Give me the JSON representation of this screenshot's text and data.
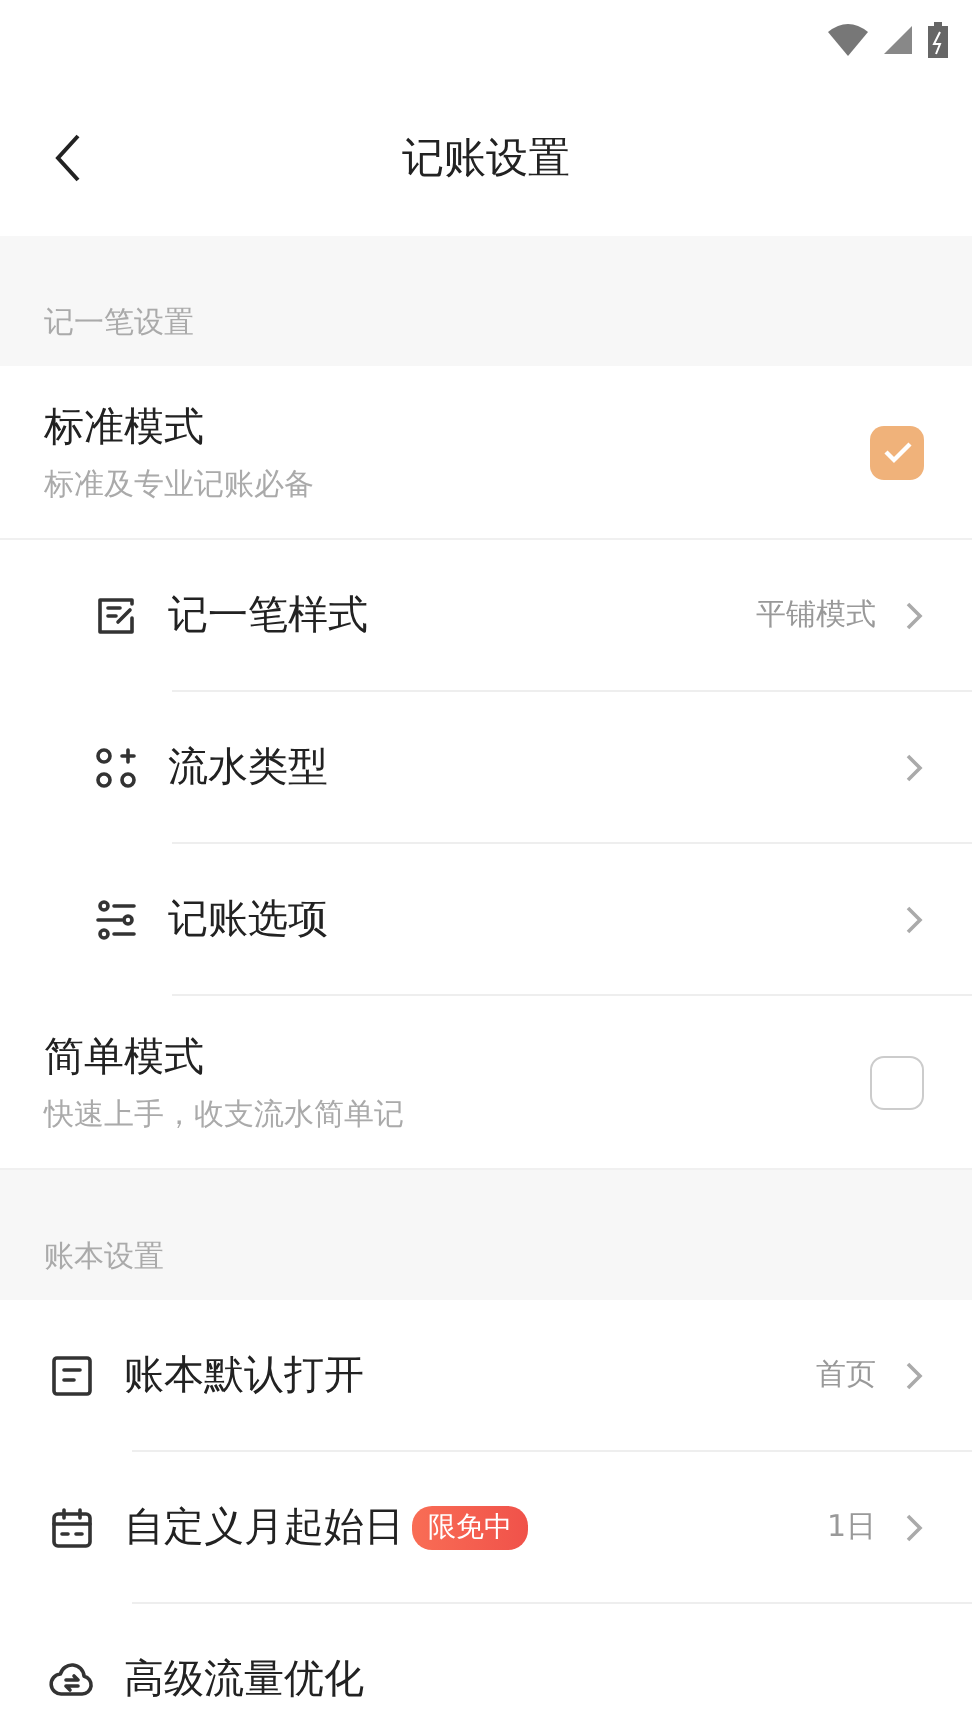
{
  "title": "记账设置",
  "sections": [
    {
      "header": "记一笔设置",
      "items": [
        {
          "kind": "mode",
          "label": "标准模式",
          "description": "标准及专业记账必备",
          "checked": true
        },
        {
          "kind": "sub",
          "label": "记一笔样式",
          "value": "平铺模式",
          "chevron": true
        },
        {
          "kind": "sub",
          "label": "流水类型",
          "chevron": true
        },
        {
          "kind": "sub",
          "label": "记账选项",
          "chevron": true
        },
        {
          "kind": "mode",
          "label": "简单模式",
          "description": "快速上手，收支流水简单记",
          "checked": false
        }
      ]
    },
    {
      "header": "账本设置",
      "items": [
        {
          "kind": "link",
          "label": "账本默认打开",
          "value": "首页",
          "chevron": true
        },
        {
          "kind": "link",
          "label": "自定义月起始日",
          "badge": "限免中",
          "value": "1日",
          "chevron": true
        },
        {
          "kind": "link",
          "label": "高级流量优化",
          "chevron": false
        }
      ]
    }
  ]
}
